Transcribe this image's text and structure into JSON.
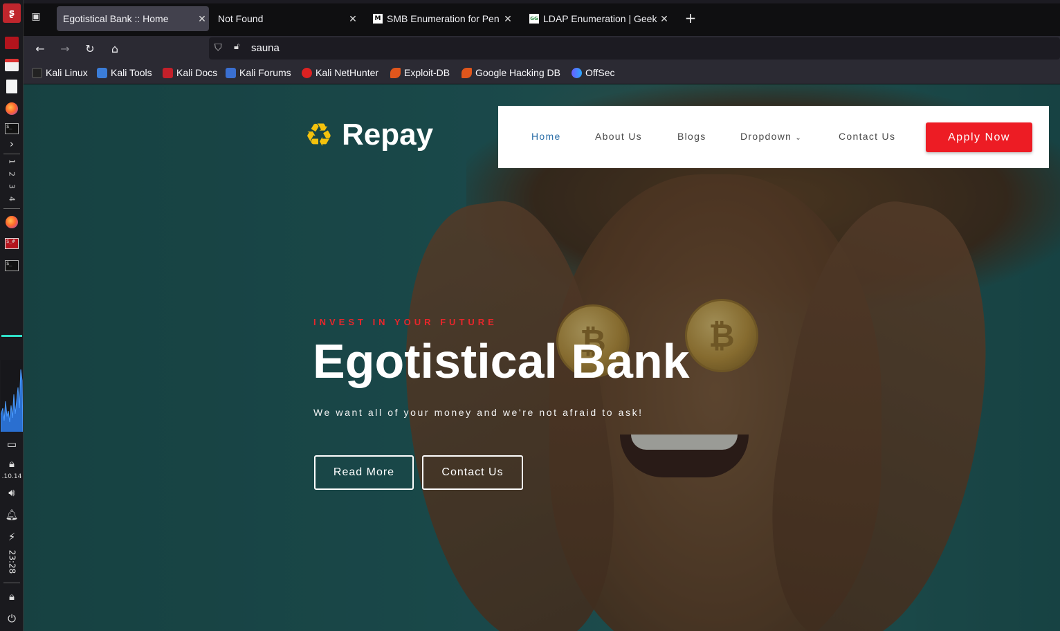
{
  "desktop": {
    "workspaces": [
      "1",
      "2",
      "3",
      "4"
    ],
    "ip_fragment": ".10.14",
    "clock": "23:28"
  },
  "browser": {
    "tabs": [
      {
        "label": "Egotistical Bank :: Home",
        "active": true
      },
      {
        "label": "Not Found",
        "active": false
      },
      {
        "label": "SMB Enumeration for Pen",
        "active": false,
        "favicon": "M"
      },
      {
        "label": "LDAP Enumeration | Geek",
        "active": false,
        "favicon": "GG"
      }
    ],
    "url": "sauna",
    "bookmarks": [
      {
        "label": "Kali Linux"
      },
      {
        "label": "Kali Tools"
      },
      {
        "label": "Kali Docs"
      },
      {
        "label": "Kali Forums"
      },
      {
        "label": "Kali NetHunter"
      },
      {
        "label": "Exploit-DB"
      },
      {
        "label": "Google Hacking DB"
      },
      {
        "label": "OffSec"
      }
    ]
  },
  "site": {
    "logo_text": "Repay",
    "nav": {
      "home": "Home",
      "about": "About Us",
      "blogs": "Blogs",
      "dropdown": "Dropdown",
      "contact": "Contact Us",
      "apply": "Apply Now"
    },
    "hero": {
      "tagline": "INVEST IN YOUR FUTURE",
      "title": "Egotistical Bank",
      "subtitle": "We want all of your money and we're not afraid to ask!",
      "read_more": "Read More",
      "contact": "Contact Us"
    }
  },
  "colors": {
    "accent_red": "#ed1c24",
    "nav_active": "#2c6fa8",
    "logo_yellow": "#f4c20d",
    "hero_bg": "#236466"
  }
}
